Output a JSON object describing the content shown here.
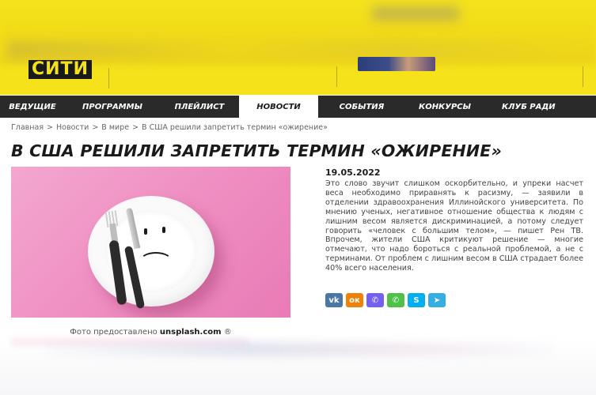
{
  "site": {
    "logo_text": "СИТИ"
  },
  "nav": {
    "items": [
      {
        "label": "ВЕДУЩИЕ",
        "active": false
      },
      {
        "label": "ПРОГРАММЫ",
        "active": false
      },
      {
        "label": "ПЛЕЙЛИСТ",
        "active": false
      },
      {
        "label": "НОВОСТИ",
        "active": true
      },
      {
        "label": "СОБЫТИЯ",
        "active": false
      },
      {
        "label": "КОНКУРСЫ",
        "active": false
      },
      {
        "label": "КЛУБ РАДИ",
        "active": false
      }
    ]
  },
  "breadcrumb": {
    "items": [
      "Главная",
      "Новости",
      "В мире",
      "В США решили запретить термин «ожирение»"
    ],
    "separator": ">"
  },
  "article": {
    "title": "В США РЕШИЛИ ЗАПРЕТИТЬ ТЕРМИН «ОЖИРЕНИЕ»",
    "date": "19.05.2022",
    "body": "Это слово звучит слишком оскорбительно, и упреки насчет веса необходимо приравнять к расизму, — заявили в отделении здравоохранения Иллинойского университета. По мнению ученых, негативное отношение общества к людям с лишним весом является дискриминацией, а потому следует говорить «человек с большим телом», — пишет Рен ТВ. Впрочем, жители США критикуют решение — многие отмечают, что надо бороться с реальной проблемой, а не с терминами. От проблем с лишним весом в США страдает более 40% всего населения.",
    "photo_caption_prefix": "Фото предоставлено",
    "photo_caption_source": "unsplash.com",
    "photo_caption_suffix": "®"
  },
  "share": [
    {
      "name": "vk-icon",
      "glyph": "vk",
      "color": "#4a76a8"
    },
    {
      "name": "odnoklassniki-icon",
      "glyph": "ок",
      "color": "#ee8208"
    },
    {
      "name": "viber-icon",
      "glyph": "✆",
      "color": "#7360f2"
    },
    {
      "name": "whatsapp-icon",
      "glyph": "✆",
      "color": "#4dc247"
    },
    {
      "name": "skype-icon",
      "glyph": "S",
      "color": "#00aff0"
    },
    {
      "name": "telegram-icon",
      "glyph": "➤",
      "color": "#37aee2"
    }
  ],
  "colors": {
    "brand_yellow": "#f5e21b",
    "nav_bg": "#2a2a2a"
  }
}
